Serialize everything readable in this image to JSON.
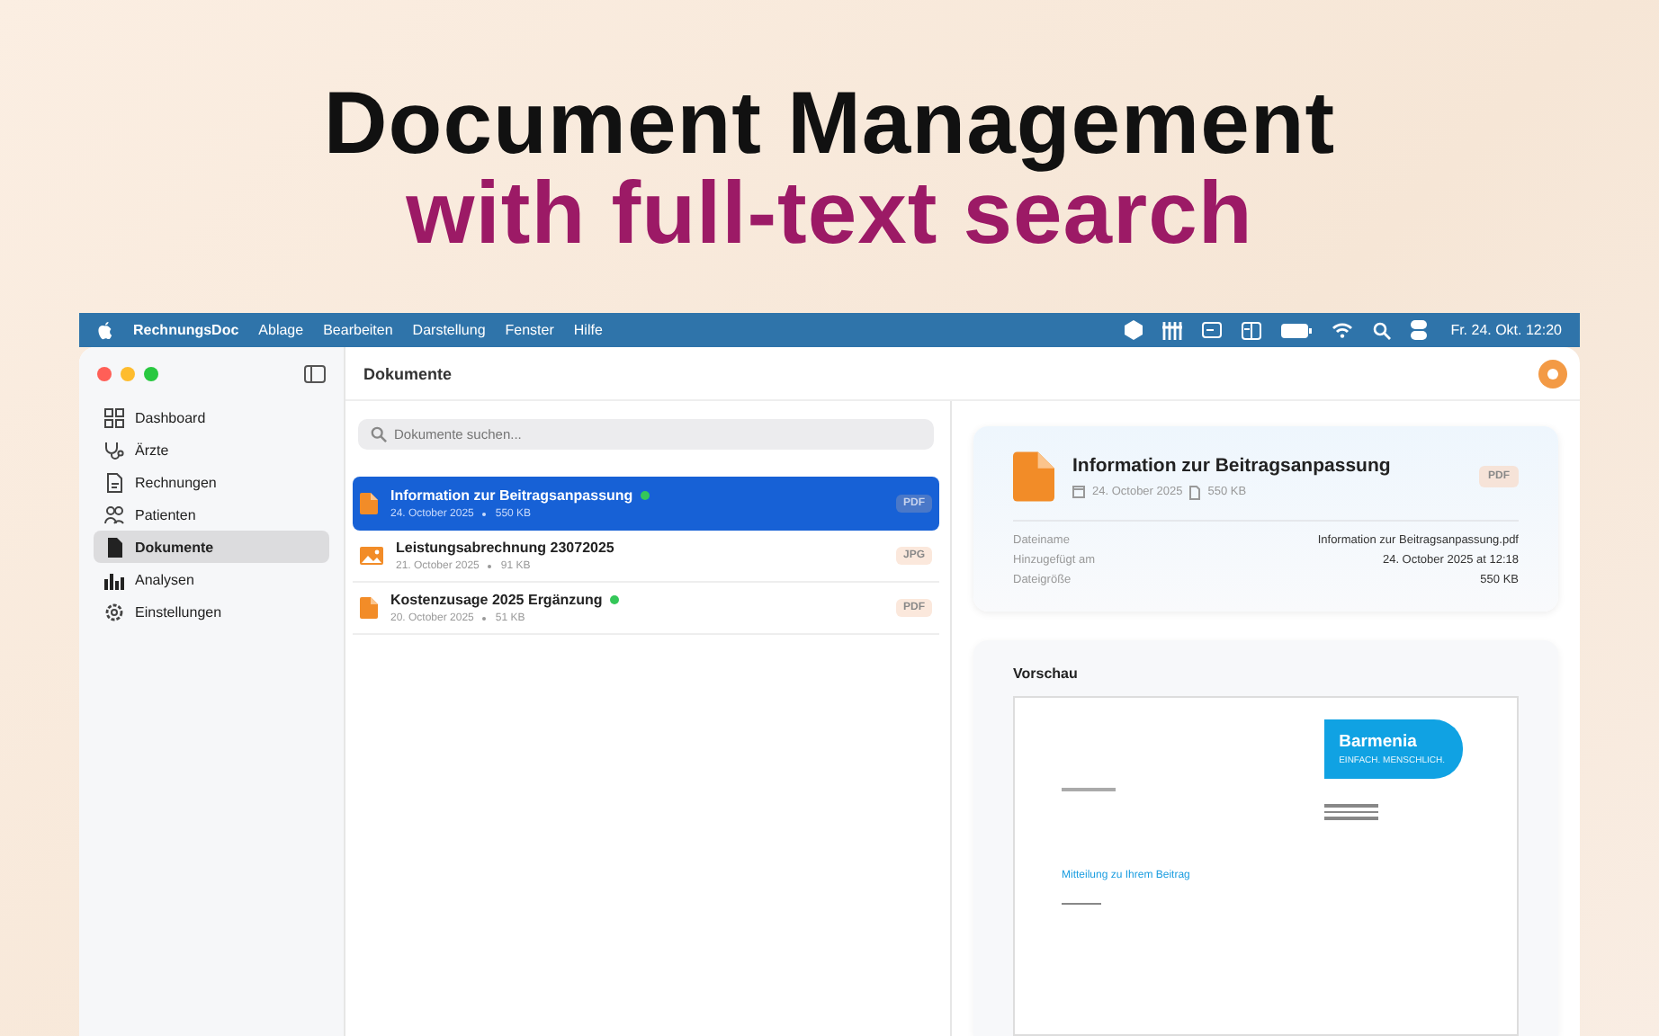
{
  "headline": {
    "line1": "Document Management",
    "line2": "with full-text search"
  },
  "menu_bar": {
    "app_name": "RechnungsDoc",
    "menus": [
      "Ablage",
      "Bearbeiten",
      "Darstellung",
      "Fenster",
      "Hilfe"
    ],
    "clock": "Fr. 24. Okt.  12:20"
  },
  "sidebar": {
    "items": [
      {
        "label": "Dashboard",
        "selected": false
      },
      {
        "label": "Ärzte",
        "selected": false
      },
      {
        "label": "Rechnungen",
        "selected": false
      },
      {
        "label": "Patienten",
        "selected": false
      },
      {
        "label": "Dokumente",
        "selected": true
      },
      {
        "label": "Analysen",
        "selected": false
      },
      {
        "label": "Einstellungen",
        "selected": false
      }
    ]
  },
  "toolbar": {
    "title": "Dokumente"
  },
  "search": {
    "placeholder": "Dokumente suchen..."
  },
  "documents": [
    {
      "kind": "document",
      "title": "Information zur Beitragsanpassung",
      "date": "24. October 2025",
      "size": "550 KB",
      "type": "PDF",
      "verified": true,
      "selected": true
    },
    {
      "kind": "image",
      "title": "Leistungsabrechnung 23072025",
      "date": "21. October 2025",
      "size": "91 KB",
      "type": "JPG",
      "verified": false,
      "selected": false
    },
    {
      "kind": "document",
      "title": "Kostenzusage  2025 Ergänzung",
      "date": "20. October 2025",
      "size": "51 KB",
      "type": "PDF",
      "verified": true,
      "selected": false
    }
  ],
  "detail": {
    "title": "Information zur Beitragsanpassung",
    "date": "24. October 2025",
    "size": "550 KB",
    "type": "PDF",
    "properties": [
      {
        "label": "Dateiname",
        "value": "Information zur Beitragsanpassung.pdf"
      },
      {
        "label": "Hinzugefügt am",
        "value": "24. October 2025 at 12:18"
      },
      {
        "label": "Dateigröße",
        "value": "550 KB"
      }
    ],
    "preview": {
      "heading": "Vorschau",
      "logo_name": "Barmenia",
      "logo_tagline": "EINFACH. MENSCHLICH.",
      "subject": "Mitteilung zu Ihrem Beitrag"
    }
  }
}
